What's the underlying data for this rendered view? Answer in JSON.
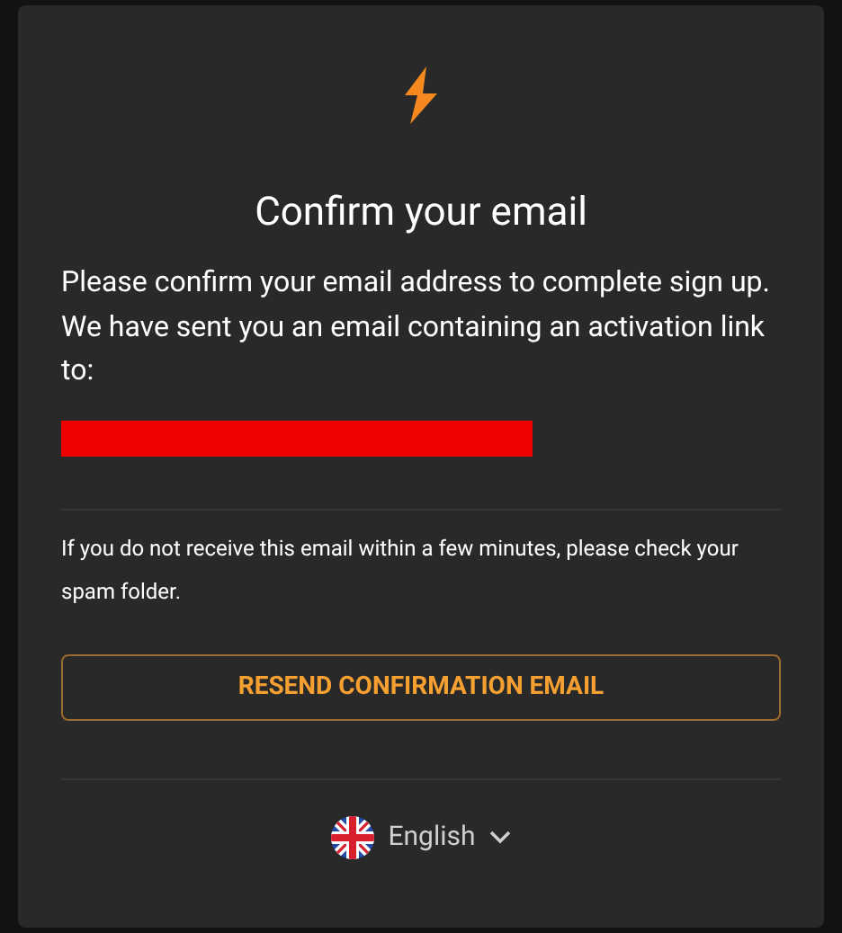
{
  "title": "Confirm your email",
  "message": "Please confirm your email address to complete sign up. We have sent you an email containing an activation link to:",
  "email_redacted": true,
  "note": "If you do not receive this email within a few minutes, please check your spam folder.",
  "resend_button": "RESEND CONFIRMATION EMAIL",
  "language": {
    "label": "English"
  }
}
